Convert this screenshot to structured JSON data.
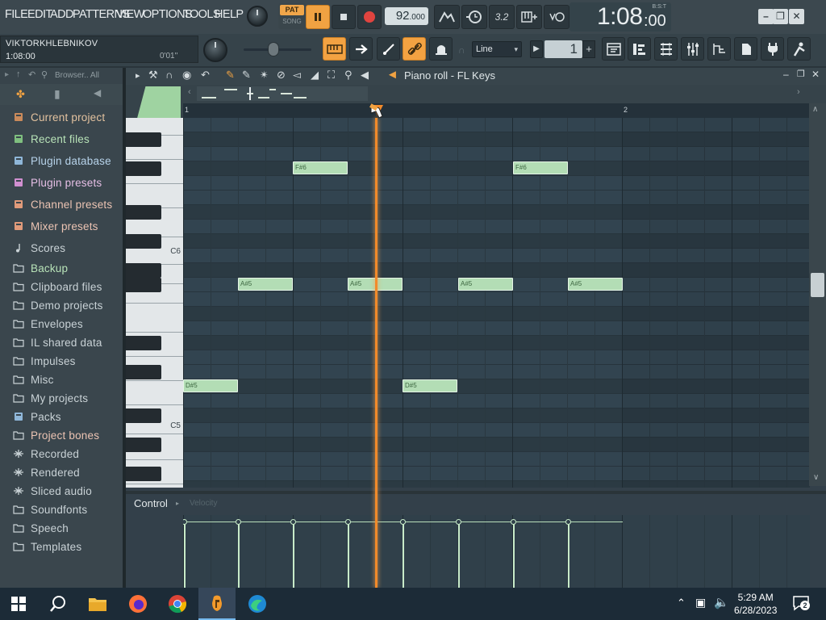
{
  "menu": [
    "FILE",
    "EDIT",
    "ADD",
    "PATTERNS",
    "VIEW",
    "OPTIONS",
    "TOOLS",
    "HELP"
  ],
  "transport": {
    "pat_label": "PAT",
    "song_label": "SONG",
    "tempo_int": "92",
    "tempo_frac": ".000",
    "time_main": "1:08",
    "time_sub": ":00",
    "time_mode": "B:S:T",
    "pattern_number": "3.2"
  },
  "hint": {
    "user": "VIKTORKHLEBNIKOV",
    "position": "1:08:00",
    "elapsed": "0'01''"
  },
  "snap": {
    "value": "Line"
  },
  "pattern": {
    "number": "1"
  },
  "browser": {
    "title": "Browser.. All",
    "items": [
      {
        "label": "Current project",
        "icon": "project-icon"
      },
      {
        "label": "Recent files",
        "icon": "recent-files-icon"
      },
      {
        "label": "Plugin database",
        "icon": "plugin-database-icon"
      },
      {
        "label": "Plugin presets",
        "icon": "plugin-presets-icon"
      },
      {
        "label": "Channel presets",
        "icon": "channel-presets-icon"
      },
      {
        "label": "Mixer presets",
        "icon": "mixer-presets-icon"
      },
      {
        "label": "Scores",
        "icon": "music-note-icon"
      },
      {
        "label": "Backup",
        "icon": "folder-icon"
      },
      {
        "label": "Clipboard files",
        "icon": "folder-icon"
      },
      {
        "label": "Demo projects",
        "icon": "folder-icon"
      },
      {
        "label": "Envelopes",
        "icon": "folder-icon"
      },
      {
        "label": "IL shared data",
        "icon": "folder-icon"
      },
      {
        "label": "Impulses",
        "icon": "folder-icon"
      },
      {
        "label": "Misc",
        "icon": "folder-icon"
      },
      {
        "label": "My projects",
        "icon": "folder-icon"
      },
      {
        "label": "Packs",
        "icon": "packs-icon"
      },
      {
        "label": "Project bones",
        "icon": "folder-icon"
      },
      {
        "label": "Recorded",
        "icon": "recorded-icon"
      },
      {
        "label": "Rendered",
        "icon": "rendered-icon"
      },
      {
        "label": "Sliced audio",
        "icon": "sliced-audio-icon"
      },
      {
        "label": "Soundfonts",
        "icon": "folder-icon"
      },
      {
        "label": "Speech",
        "icon": "folder-icon"
      },
      {
        "label": "Templates",
        "icon": "folder-icon"
      }
    ]
  },
  "piano_roll": {
    "title": "Piano roll - FL Keys",
    "bar_labels": [
      "1",
      "2"
    ],
    "key_labels": [
      "C6",
      "C5"
    ],
    "notes": [
      {
        "label": "F#6"
      },
      {
        "label": "F#6"
      },
      {
        "label": "A#5"
      },
      {
        "label": "A#5"
      },
      {
        "label": "A#5"
      },
      {
        "label": "A#5"
      },
      {
        "label": "D#5"
      },
      {
        "label": "D#5"
      }
    ],
    "control_label": "Control",
    "control_param": "Velocity"
  },
  "taskbar": {
    "time": "5:29 AM",
    "date": "6/28/2023",
    "notifications": "2"
  }
}
